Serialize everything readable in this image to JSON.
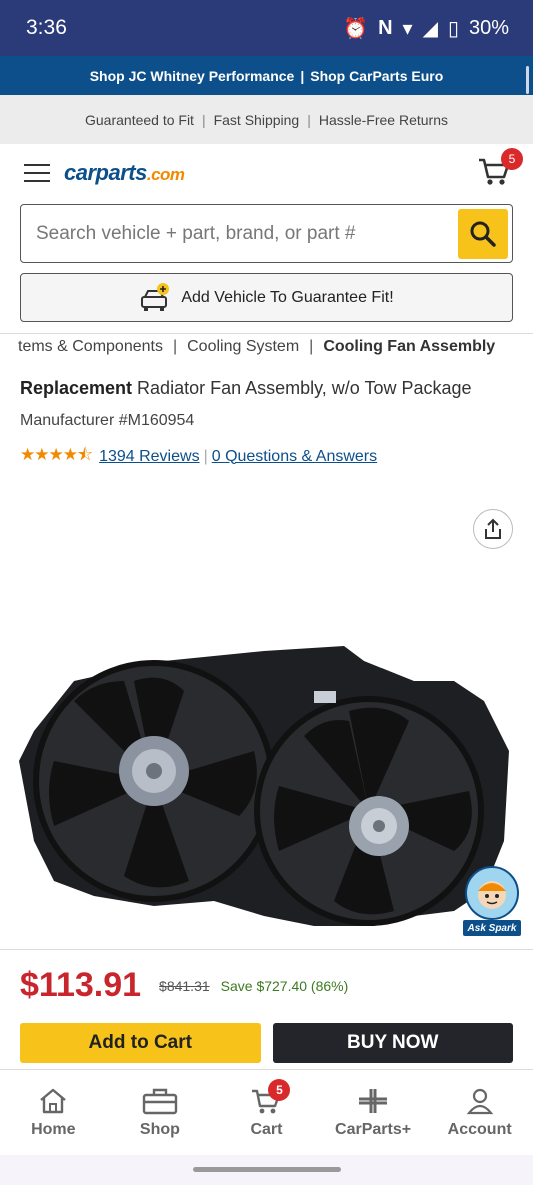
{
  "status": {
    "time": "3:36",
    "battery": "30%"
  },
  "promo": {
    "link1": "Shop JC Whitney Performance",
    "link2": "Shop CarParts Euro"
  },
  "trust": [
    "Guaranteed to Fit",
    "Fast Shipping",
    "Hassle-Free Returns"
  ],
  "header": {
    "logo_main": "carparts",
    "logo_suffix": ".com",
    "cart_count": "5"
  },
  "search": {
    "placeholder": "Search vehicle + part, brand, or part #"
  },
  "add_vehicle": {
    "label": "Add Vehicle To Guarantee Fit!"
  },
  "breadcrumbs": [
    "tems & Components",
    "Cooling System",
    "Cooling Fan Assembly"
  ],
  "product": {
    "title_bold": "Replacement",
    "title_rest": " Radiator Fan Assembly, w/o Tow Package",
    "manufacturer": "Manufacturer #M160954",
    "reviews": "1394 Reviews",
    "qa": "0 Questions & Answers",
    "price": "$113.91",
    "original_price": "$841.31",
    "savings": "Save $727.40 (86%)"
  },
  "spark": {
    "label": "Ask Spark"
  },
  "actions": {
    "add_to_cart": "Add to Cart",
    "buy_now": "BUY NOW"
  },
  "nav": [
    {
      "label": "Home",
      "icon": "home-icon"
    },
    {
      "label": "Shop",
      "icon": "toolbox-icon"
    },
    {
      "label": "Cart",
      "icon": "cart-icon",
      "badge": "5"
    },
    {
      "label": "CarParts+",
      "icon": "carparts-plus-icon"
    },
    {
      "label": "Account",
      "icon": "account-icon"
    }
  ],
  "colors": {
    "brand_blue": "#0d4f8a",
    "accent_yellow": "#f7c21a",
    "price_red": "#c9252c",
    "save_green": "#3d7a22"
  }
}
